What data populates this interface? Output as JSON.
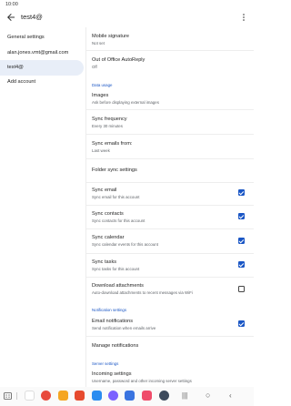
{
  "status_bar": {
    "time": "10:00"
  },
  "header": {
    "title": "test4@"
  },
  "left_pane": {
    "items": [
      {
        "label": "General settings"
      },
      {
        "label": "alan.jones.vmt@gmail.com"
      },
      {
        "label": "test4@"
      },
      {
        "label": "Add account"
      }
    ]
  },
  "settings": {
    "mobile_signature": {
      "title": "Mobile signature",
      "sub": "Not set"
    },
    "out_of_office": {
      "title": "Out of Office AutoReply",
      "sub": "Off"
    },
    "data_usage_head": "Data usage",
    "images": {
      "title": "Images",
      "sub": "Ask before displaying external images"
    },
    "sync_frequency": {
      "title": "Sync frequency",
      "sub": "Every 30 minutes"
    },
    "sync_emails_from": {
      "title": "Sync emails from:",
      "sub": "Last week"
    },
    "folder_sync": {
      "title": "Folder sync settings"
    },
    "sync_email": {
      "title": "Sync email",
      "sub": "Sync email for this account",
      "checked": true
    },
    "sync_contacts": {
      "title": "Sync contacts",
      "sub": "Sync contacts for this account",
      "checked": true
    },
    "sync_calendar": {
      "title": "Sync calendar",
      "sub": "Sync calendar events for this account",
      "checked": true
    },
    "sync_tasks": {
      "title": "Sync tasks",
      "sub": "Sync tasks for this account",
      "checked": true
    },
    "download_attachments": {
      "title": "Download attachments",
      "sub": "Auto-download attachments to recent messages via WiFi",
      "checked": false
    },
    "notification_head": "Notification settings",
    "email_notifications": {
      "title": "Email notifications",
      "sub": "Send notification when emails arrive",
      "checked": true
    },
    "manage_notifications": {
      "title": "Manage notifications"
    },
    "server_head": "Server settings",
    "incoming_settings": {
      "title": "Incoming settings",
      "sub": "Username, password and other incoming server settings"
    }
  },
  "colors": {
    "accent": "#1a56c5",
    "selected_bg": "#e8eef8"
  },
  "icons": [
    "back-arrow-icon",
    "more-vert-icon",
    "checkbox-icon"
  ]
}
